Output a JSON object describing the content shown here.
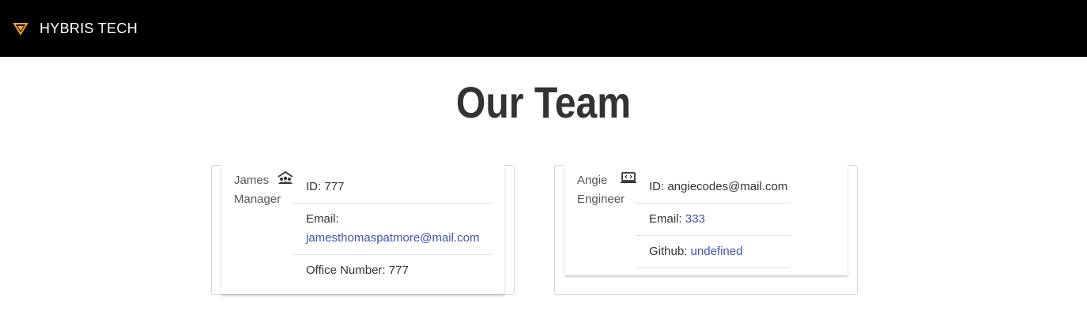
{
  "navbar": {
    "brand": "HYBRIS TECH",
    "logo_icon": "hybris-logo-icon",
    "logo_color": "#f5a623"
  },
  "page": {
    "title": "Our Team"
  },
  "team": [
    {
      "name": "James",
      "role": "Manager",
      "role_icon": "manager-icon",
      "id_label": "ID: 777",
      "email_label": "Email:",
      "email": "jamesthomaspatmore@mail.com",
      "extra_label": "Office Number: 777"
    },
    {
      "name": "Angie",
      "role": "Engineer",
      "role_icon": "laptop-code-icon",
      "id_label": "ID: angiecodes@mail.com",
      "email_label": "Email:",
      "email": "333",
      "extra_label": "Github:",
      "extra_link": "undefined"
    }
  ],
  "colors": {
    "navbar_bg": "#000000",
    "link": "#3f51b5",
    "title": "#333333"
  }
}
